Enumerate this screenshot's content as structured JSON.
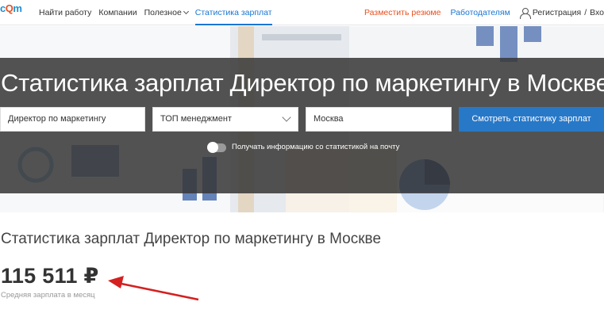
{
  "logo": {
    "prefix": "c",
    "mark": "Q",
    "suffix": "m"
  },
  "nav": {
    "items": [
      "Найти работу",
      "Компании",
      "Полезное"
    ],
    "active_item": "Статистика зарплат",
    "post_resume": "Разместить резюме",
    "employers": "Работодателям",
    "register": "Регистрация",
    "separator": "/",
    "login": "Вхо"
  },
  "hero": {
    "title": "Статистика зарплат Директор по маркетингу в Москве",
    "position_value": "Директор по маркетингу",
    "category_value": "ТОП менеджмент",
    "city_value": "Москва",
    "submit_label": "Смотреть статистику зарплат",
    "toggle_label": "Получать информацию со статистикой на почту",
    "toggle_on": false
  },
  "main": {
    "title": "Статистика зарплат Директор по маркетингу в Москве",
    "salary": "115 511 ₽",
    "salary_caption": "Средняя зарплата в месяц"
  },
  "colors": {
    "accent": "#1976d2",
    "orange": "#e9501e",
    "button": "#2878c8",
    "overlay": "#373737",
    "annotation_arrow": "#d42020"
  },
  "icons": [
    "chevron-down-icon",
    "user-icon",
    "dropdown-chevron-icon",
    "red-arrow-annotation"
  ]
}
